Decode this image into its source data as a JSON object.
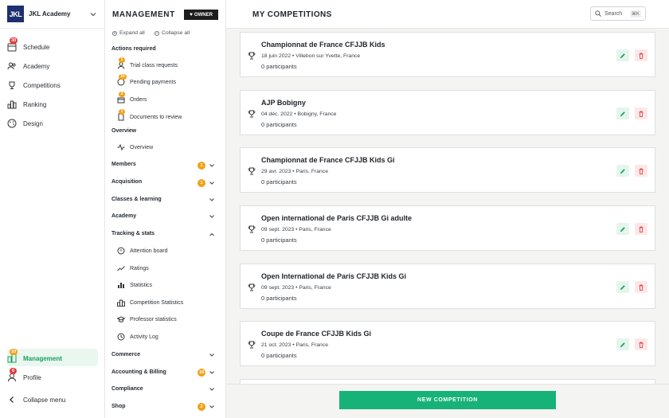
{
  "nav": {
    "academy_logo": "JKL",
    "academy_name": "JKL Academy",
    "items": [
      {
        "label": "Schedule",
        "badge": "30"
      },
      {
        "label": "Academy"
      },
      {
        "label": "Competitions"
      },
      {
        "label": "Ranking"
      },
      {
        "label": "Design"
      }
    ],
    "management": {
      "label": "Management",
      "badge": "33"
    },
    "profile": {
      "label": "Profile",
      "badge": "6"
    },
    "collapse_label": "Collapse menu"
  },
  "management": {
    "title": "MANAGEMENT",
    "owner_label": "OWNER",
    "expand_all": "Expand all",
    "collapse_all": "Collapse all",
    "actions_title": "Actions required",
    "actions": [
      {
        "label": "Trial class requests",
        "badge": "1"
      },
      {
        "label": "Pending payments",
        "badge": "10"
      },
      {
        "label": "Orders",
        "badge": "2"
      },
      {
        "label": "Documents to review",
        "badge": "1"
      }
    ],
    "overview_title": "Overview",
    "overview_item": "Overview",
    "members": {
      "label": "Members",
      "count": "1"
    },
    "acquisition": {
      "label": "Acquisition",
      "count": "1"
    },
    "classes": "Classes & learning",
    "academy": "Academy",
    "tracking": "Tracking & stats",
    "tracking_items": [
      "Attention board",
      "Ratings",
      "Statistics",
      "Competition Statistics",
      "Professor statistics",
      "Activity Log"
    ],
    "commerce": "Commerce",
    "accounting": {
      "label": "Accounting & Billing",
      "count": "18"
    },
    "compliance": "Compliance",
    "shop": {
      "label": "Shop",
      "count": "2"
    }
  },
  "main": {
    "title": "MY COMPETITIONS",
    "search_label": "Search",
    "search_shortcut": "⌘K",
    "new_button": "NEW COMPETITION",
    "competitions": [
      {
        "name": "Championnat de France CFJJB Kids",
        "meta": "18 juin 2022 • Villebon sur Yvette, France",
        "participants": "0 participants"
      },
      {
        "name": "AJP Bobigny",
        "meta": "04 déc. 2022 • Bobigny, France",
        "participants": "0 participants"
      },
      {
        "name": "Championnat de France CFJJB Kids Gi",
        "meta": "29 avr. 2023 • Paris, France",
        "participants": "0 participants"
      },
      {
        "name": "Open international de Paris CFJJB Gi adulte",
        "meta": "09 sept. 2023 • Paris, France",
        "participants": "0 participants"
      },
      {
        "name": "Open International de Paris CFJJB Kids Gi",
        "meta": "09 sept. 2023 • Paris, France",
        "participants": "0 participants"
      },
      {
        "name": "Coupe de France CFJJB Kids Gi",
        "meta": "21 oct. 2023 • Paris, France",
        "participants": "0 participants"
      }
    ]
  },
  "colors": {
    "accent": "#17b277",
    "brand": "#1d2f6f",
    "badge_red": "#e23d3d",
    "badge_orange": "#f0a21a"
  }
}
